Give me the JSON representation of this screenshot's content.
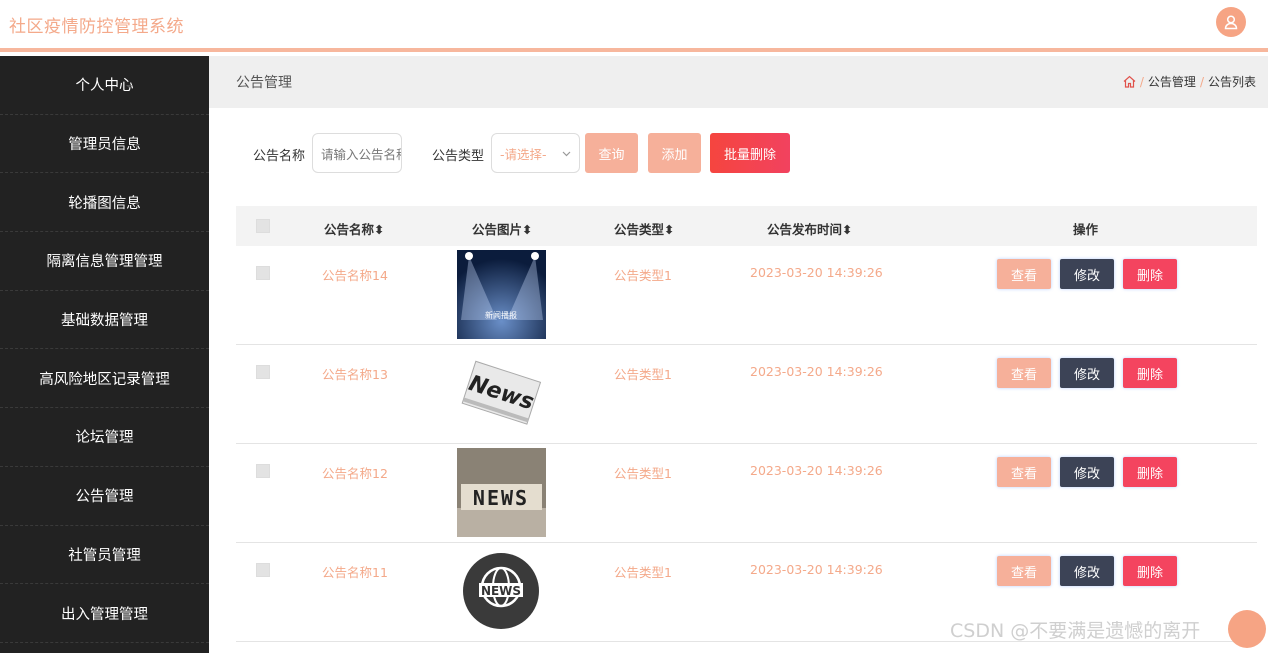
{
  "app": {
    "title": "社区疫情防控管理系统",
    "accent": "#f4a98a"
  },
  "sidebar": {
    "items": [
      {
        "label": "个人中心"
      },
      {
        "label": "管理员信息"
      },
      {
        "label": "轮播图信息"
      },
      {
        "label": "隔离信息管理管理"
      },
      {
        "label": "基础数据管理"
      },
      {
        "label": "高风险地区记录管理"
      },
      {
        "label": "论坛管理"
      },
      {
        "label": "公告管理"
      },
      {
        "label": "社管员管理"
      },
      {
        "label": "出入管理管理"
      }
    ]
  },
  "page": {
    "title": "公告管理",
    "breadcrumb": [
      "公告管理",
      "公告列表"
    ]
  },
  "search": {
    "name_label": "公告名称",
    "name_placeholder": "请输入公告名称",
    "type_label": "公告类型",
    "type_value": "-请选择-",
    "query_label": "查询",
    "add_label": "添加",
    "batch_delete_label": "批量删除"
  },
  "table": {
    "headers": [
      "公告名称",
      "公告图片",
      "公告类型",
      "公告发布时间",
      "操作"
    ],
    "rows": [
      {
        "name": "公告名称14",
        "type": "公告类型1",
        "time": "2023-03-20 14:39:26",
        "image": "stage-news-image",
        "image_text": "新闻播报"
      },
      {
        "name": "公告名称13",
        "type": "公告类型1",
        "time": "2023-03-20 14:39:26",
        "image": "newspaper-image",
        "image_text": "News"
      },
      {
        "name": "公告名称12",
        "type": "公告类型1",
        "time": "2023-03-20 14:39:26",
        "image": "news-blocks-image",
        "image_text": "NEWS"
      },
      {
        "name": "公告名称11",
        "type": "公告类型1",
        "time": "2023-03-20 14:39:26",
        "image": "globe-news-image",
        "image_text": "NEWS"
      }
    ],
    "actions": {
      "view": "查看",
      "edit": "修改",
      "delete": "删除"
    }
  },
  "watermark": "CSDN @不要满是遗憾的离开"
}
